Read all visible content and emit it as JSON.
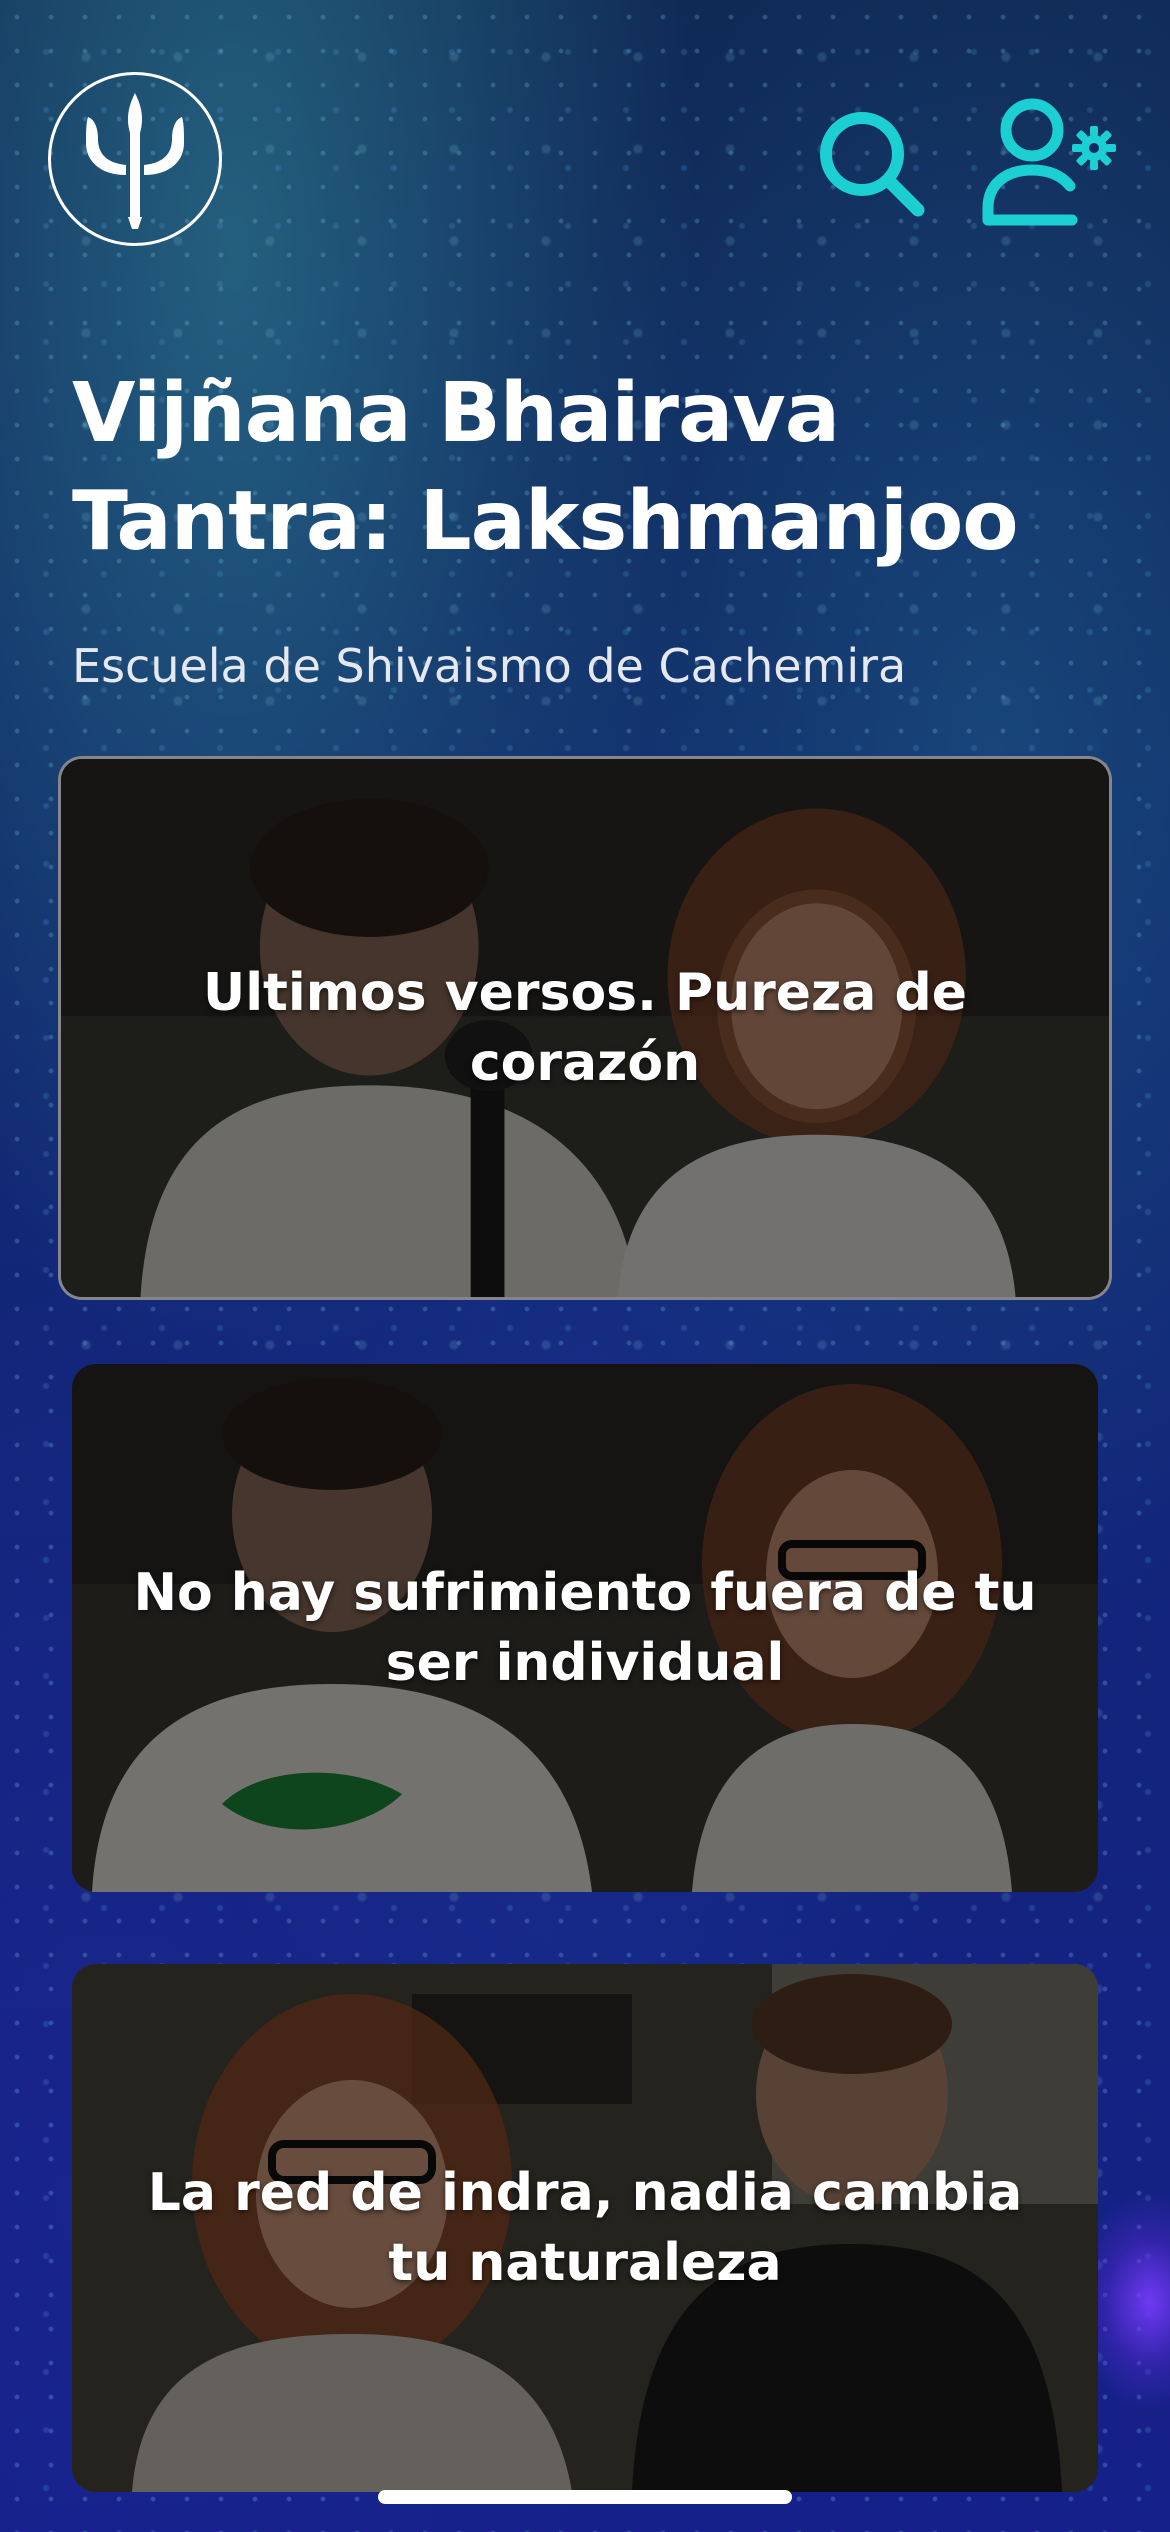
{
  "header": {
    "logo_icon": "trident-icon",
    "search_icon": "search-icon",
    "profile_icon": "user-settings-icon",
    "accent_color": "#1ccfd2"
  },
  "title": "Vijñana Bhairava Tantra: Lakshmanjoo",
  "subtitle": "Escuela de Shivaismo de Cachemira",
  "cards": [
    {
      "title": "Ultimos versos. Pureza de corazón"
    },
    {
      "title": "No hay sufrimiento fuera de tu ser individual"
    },
    {
      "title": "La red de indra, nadia cambia tu naturaleza"
    }
  ]
}
